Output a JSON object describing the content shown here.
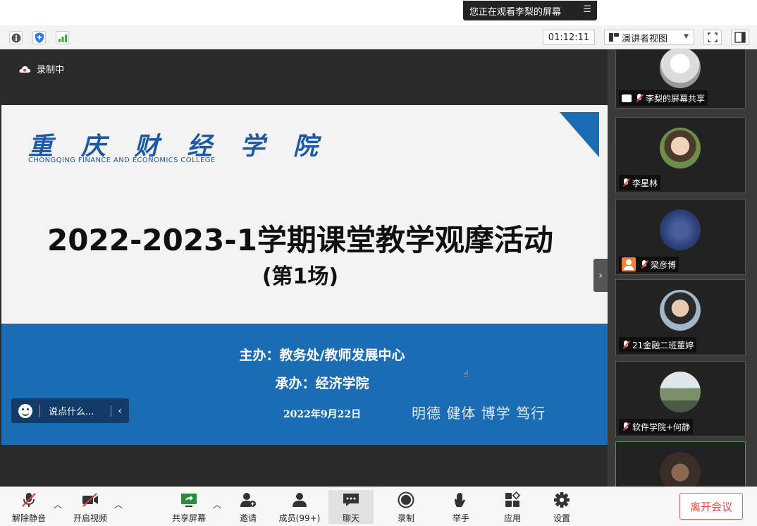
{
  "banner": {
    "sharing_text": "您正在观看李梨的屏幕",
    "menu_icon": "list-icon"
  },
  "info_bar": {
    "timer": "01:12:11",
    "view_mode": "演讲者视图",
    "colors": {
      "info": "#555555",
      "shield": "#2a7de1",
      "signal": "#3aaa35"
    }
  },
  "recording": {
    "label": "录制中"
  },
  "slide": {
    "school_cn": "重 庆 财 经 学 院",
    "school_en": "CHONGQING FINANCE AND ECONOMICS COLLEGE",
    "title": "2022-2023-1学期课堂教学观摩活动",
    "subtitle": "(第1场)",
    "organizer": "主办：教务处/教师发展中心",
    "co_organizer": "承办：经济学院",
    "date": "2022年9月22日",
    "motto": "明德  健体  博学  笃行",
    "accent_color": "#1a6db4"
  },
  "chat_box": {
    "placeholder": "说点什么...",
    "collapse_glyph": "‹"
  },
  "gallery": {
    "toggle_glyph": "›",
    "participants": [
      {
        "name": "李梨的屏幕共享",
        "type": "share"
      },
      {
        "name": "李星林",
        "type": "video"
      },
      {
        "name": "梁彦博",
        "type": "user"
      },
      {
        "name": "21金融二班董婷",
        "type": "video"
      },
      {
        "name": "软件学院+何静",
        "type": "video"
      }
    ]
  },
  "toolbar": {
    "unmute": "解除静音",
    "start_video": "开启视频",
    "share_screen": "共享屏幕",
    "invite": "邀请",
    "members": "成员(99+)",
    "chat": "聊天",
    "record": "录制",
    "raise_hand": "举手",
    "apps": "应用",
    "settings": "设置",
    "leave": "离开会议",
    "leave_color": "#e0463d"
  }
}
